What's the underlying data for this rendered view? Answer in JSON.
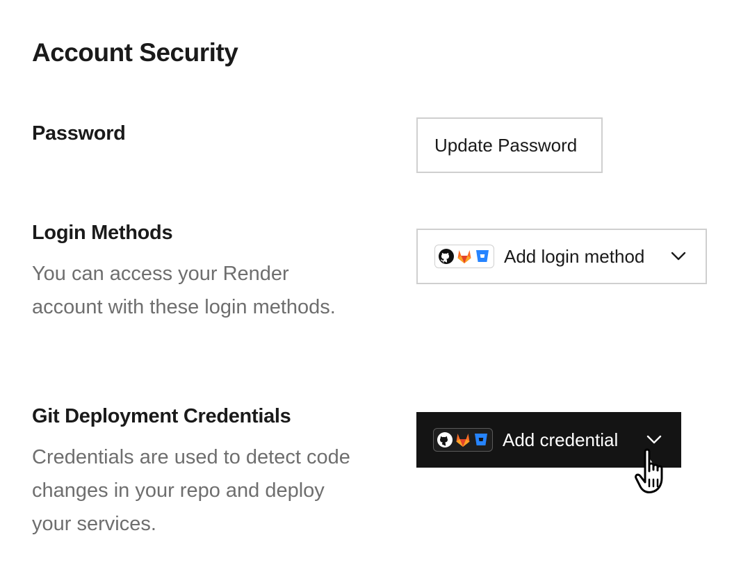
{
  "page": {
    "title": "Account Security"
  },
  "password": {
    "title": "Password",
    "button_label": "Update Password"
  },
  "login_methods": {
    "title": "Login Methods",
    "description": "You can access your Render account with these login methods.",
    "button_label": "Add login method",
    "providers": [
      "github-icon",
      "gitlab-icon",
      "bitbucket-icon"
    ]
  },
  "git_credentials": {
    "title": "Git Deployment Credentials",
    "description": "Credentials are used to detect code changes in your repo and deploy your services.",
    "button_label": "Add credential",
    "providers": [
      "github-icon",
      "gitlab-icon",
      "bitbucket-icon"
    ]
  },
  "colors": {
    "primary_dark": "#141414",
    "muted_text": "#6e6e6e",
    "border": "#cfcfcf",
    "gitlab_orange": "#fc6d26",
    "bitbucket_blue": "#2684ff"
  }
}
